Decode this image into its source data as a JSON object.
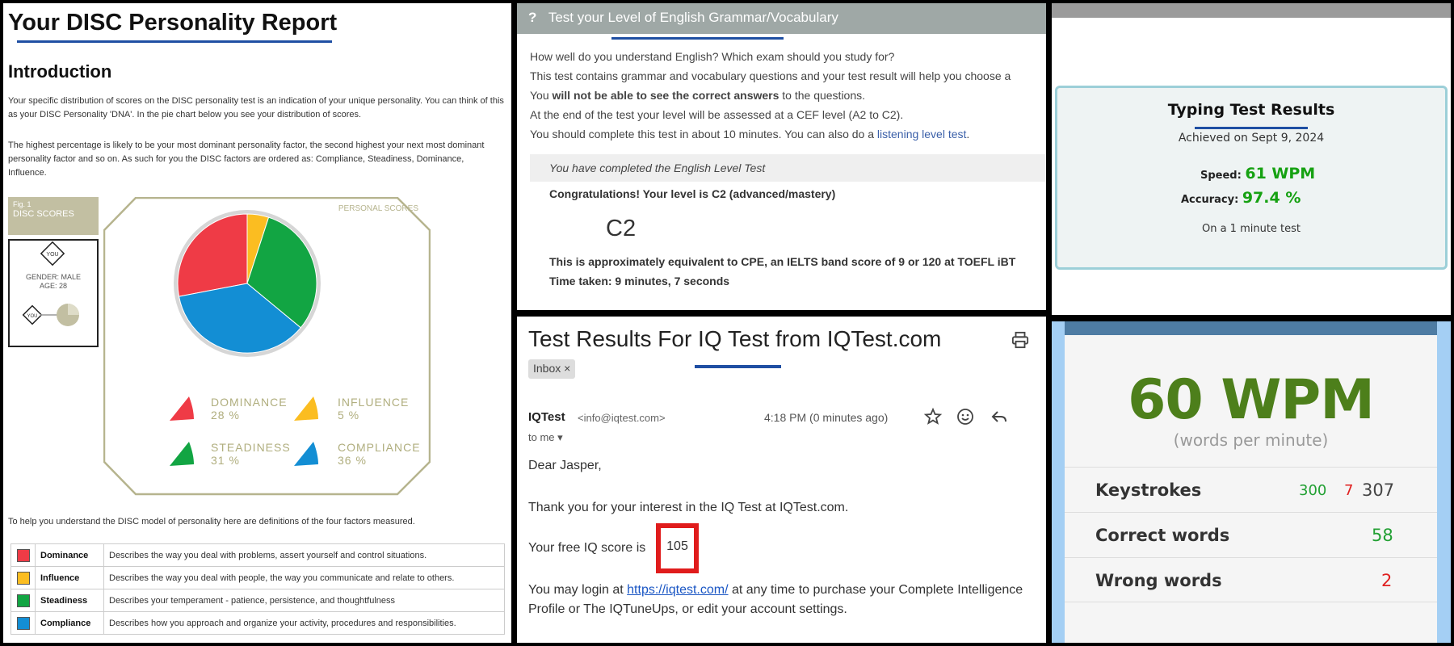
{
  "disc": {
    "title": "Your DISC Personality Report",
    "intro_heading": "Introduction",
    "para1": "Your specific distribution of scores on the DISC personality test is an indication of your unique personality. You can think of this as your DISC Personality 'DNA'. In the pie chart below you see your distribution of scores.",
    "para2": "The highest percentage is likely to be your most dominant personality factor, the second highest your next most dominant personality factor and so on. As such for you the DISC factors are ordered as: Compliance, Steadiness, Dominance, Influence.",
    "fig_label": "Fig. 1",
    "fig_title": "DISC SCORES",
    "you_label": "YOU",
    "gender": "GENDER: MALE",
    "age": "AGE: 28",
    "personal_scores": "PERSONAL SCORES",
    "definitions_intro": "To help you understand the DISC model of personality here are definitions of the four factors measured.",
    "colors": {
      "dominance": "#ef3b46",
      "influence": "#fbbd21",
      "steadiness": "#12a543",
      "compliance": "#138ed4"
    },
    "legend": [
      {
        "name": "DOMINANCE",
        "pct": "28 %"
      },
      {
        "name": "INFLUENCE",
        "pct": "5 %"
      },
      {
        "name": "STEADINESS",
        "pct": "31 %"
      },
      {
        "name": "COMPLIANCE",
        "pct": "36 %"
      }
    ],
    "definitions": [
      {
        "name": "Dominance",
        "desc": "Describes the way you deal with problems, assert yourself and control situations."
      },
      {
        "name": "Influence",
        "desc": "Describes the way you deal with people, the way you communicate and relate to others."
      },
      {
        "name": "Steadiness",
        "desc": "Describes your temperament - patience, persistence, and thoughtfulness"
      },
      {
        "name": "Compliance",
        "desc": "Describes how you approach and organize your activity, procedures and responsibilities."
      }
    ],
    "chart_data": {
      "type": "pie",
      "categories": [
        "Dominance",
        "Influence",
        "Steadiness",
        "Compliance"
      ],
      "values": [
        28,
        5,
        31,
        36
      ],
      "title": "DISC SCORES",
      "legend_position": "bottom"
    }
  },
  "english": {
    "icon": "?",
    "title": "Test your Level of English Grammar/Vocabulary",
    "line1": "How well do you understand English? Which exam should you study for?",
    "line2": "This test contains grammar and vocabulary questions and your test result will help you choose a",
    "line3_pre": "You ",
    "line3_bold": "will not be able to see the correct answers",
    "line3_post": " to the questions.",
    "line4": "At the end of the test your level will be assessed at a CEF level (A2 to C2).",
    "line5_pre": "You should complete this test in about 10 minutes. You can also do a ",
    "line5_link": "listening level test",
    "line5_post": ".",
    "completed": "You have completed the English Level Test",
    "congrats": "Congratulations! Your level is C2 (advanced/mastery)",
    "level": "C2",
    "equivalent": "This is approximately equivalent to CPE, an IELTS band score of 9 or 120 at TOEFL iBT",
    "time_taken": "Time taken: 9 minutes, 7 seconds"
  },
  "iq": {
    "subject": "Test Results For IQ Test from IQTest.com",
    "chip": "Inbox ×",
    "sender": "IQTest",
    "sender_email": "<info@iqtest.com>",
    "time": "4:18 PM (0 minutes ago)",
    "to": "to me ▾",
    "greeting": "Dear Jasper,",
    "thanks": "Thank you for your interest in the IQ Test at IQTest.com.",
    "score_label": "Your free IQ score is",
    "score": "105",
    "login_pre": "You may login at ",
    "login_link": "https://iqtest.com/",
    "login_post": " at any time to purchase your Complete Intelligence",
    "login_line2": "Profile or The IQTuneUps, or edit your account settings."
  },
  "typing": {
    "title": "Typing Test Results",
    "date": "Achieved on Sept 9, 2024",
    "speed_label": "Speed:",
    "speed": "61 WPM",
    "accuracy_label": "Accuracy:",
    "accuracy": "97.4 %",
    "footer": "On a 1 minute test"
  },
  "wpm": {
    "big": "60 WPM",
    "sub": "(words per minute)",
    "keystrokes_label": "Keystrokes",
    "keystrokes_correct": "300",
    "keystrokes_wrong": "7",
    "keystrokes_total": "307",
    "correct_label": "Correct words",
    "correct": "58",
    "wrong_label": "Wrong words",
    "wrong": "2"
  }
}
